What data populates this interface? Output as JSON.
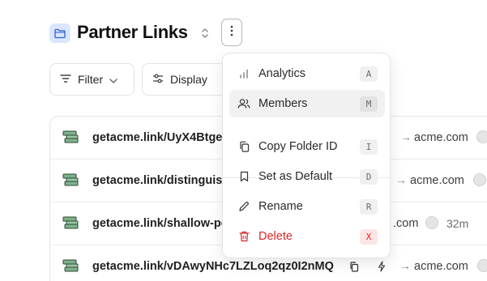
{
  "header": {
    "title": "Partner Links",
    "folder_icon": "folder-icon",
    "badge_color": "#dbe6fe",
    "switcher_icon": "chevron-up-down-icon",
    "more_icon": "vertical-dots-icon"
  },
  "toolbar": {
    "filter_label": "Filter",
    "display_label": "Display"
  },
  "links": [
    {
      "short": "getacme.link/UyX4Btge",
      "dest": "acme.com",
      "time": ""
    },
    {
      "short": "getacme.link/distinguish",
      "dest": "acme.com",
      "time": ""
    },
    {
      "short": "getacme.link/shallow-pe",
      "dest": ".com",
      "time": "32m"
    },
    {
      "short": "getacme.link/vDAwyNHc7LZLoq2qz0I2nMQ",
      "dest": "acme.com",
      "time": ""
    }
  ],
  "menu": {
    "items": [
      {
        "label": "Analytics",
        "shortcut": "A",
        "icon": "bar-chart-icon"
      },
      {
        "label": "Members",
        "shortcut": "M",
        "icon": "users-icon"
      },
      {
        "label": "Copy Folder ID",
        "shortcut": "I",
        "icon": "copy-icon"
      },
      {
        "label": "Set as Default",
        "shortcut": "D",
        "icon": "bookmark-icon"
      },
      {
        "label": "Rename",
        "shortcut": "R",
        "icon": "pencil-icon"
      },
      {
        "label": "Delete",
        "shortcut": "X",
        "icon": "trash-icon"
      }
    ],
    "danger_color": "#dc2626"
  }
}
